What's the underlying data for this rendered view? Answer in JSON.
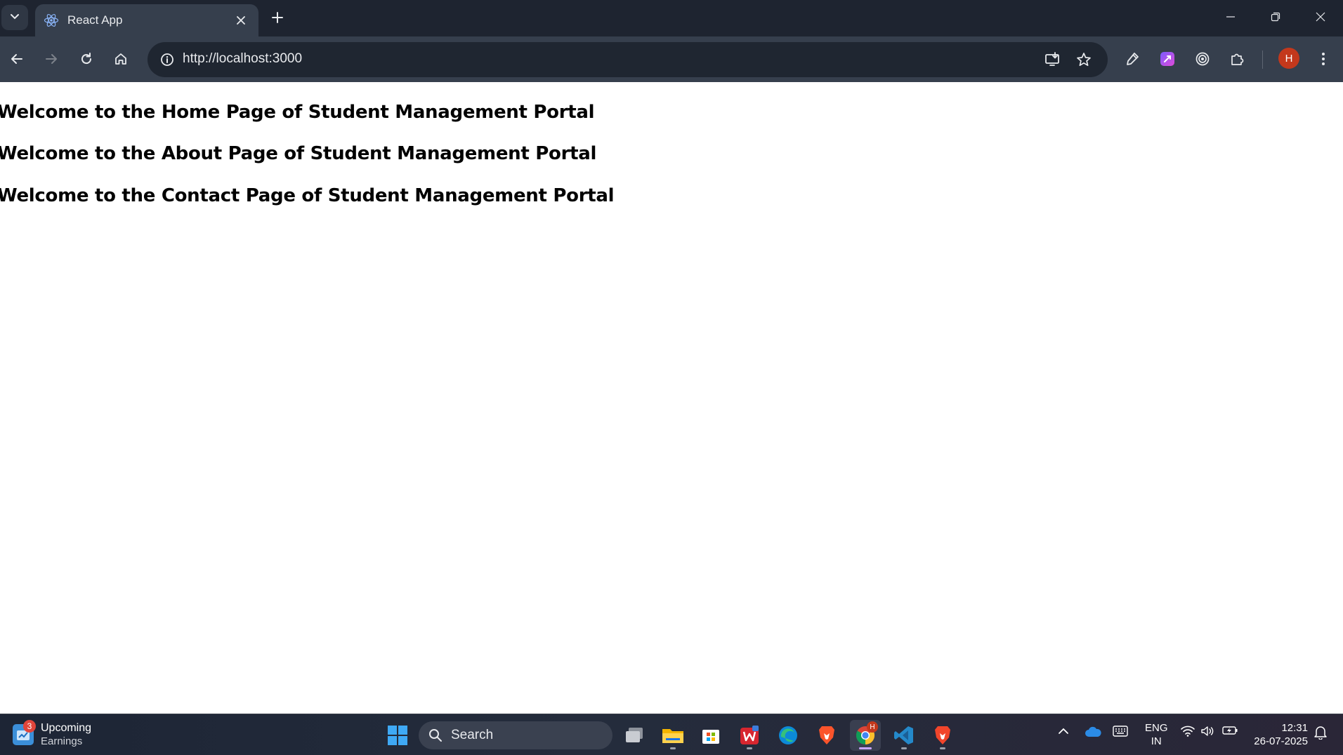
{
  "browser": {
    "tab": {
      "title": "React App",
      "favicon": "react-icon"
    },
    "address_bar": {
      "url": "http://localhost:3000"
    },
    "profile": {
      "initial": "H",
      "color": "#c3381c"
    }
  },
  "page": {
    "headings": [
      "Welcome to the Home Page of Student Management Portal",
      "Welcome to the About Page of Student Management Portal",
      "Welcome to the Contact Page of Student Management Portal"
    ]
  },
  "taskbar": {
    "widget": {
      "badge": "3",
      "line1": "Upcoming",
      "line2": "Earnings"
    },
    "search_label": "Search",
    "apps": [
      "task-view",
      "file-explorer",
      "microsoft-store",
      "wps-office",
      "edge",
      "brave",
      "chrome",
      "vscode",
      "brave-beta"
    ],
    "language": {
      "line1": "ENG",
      "line2": "IN"
    },
    "clock": {
      "time": "12:31",
      "date": "26-07-2025"
    },
    "chrome_badge": "H"
  },
  "colors": {
    "tabstrip": "#1e2430",
    "toolbar": "#363f4d",
    "page_bg": "#ffffff",
    "accent_avatar": "#c3381c"
  }
}
